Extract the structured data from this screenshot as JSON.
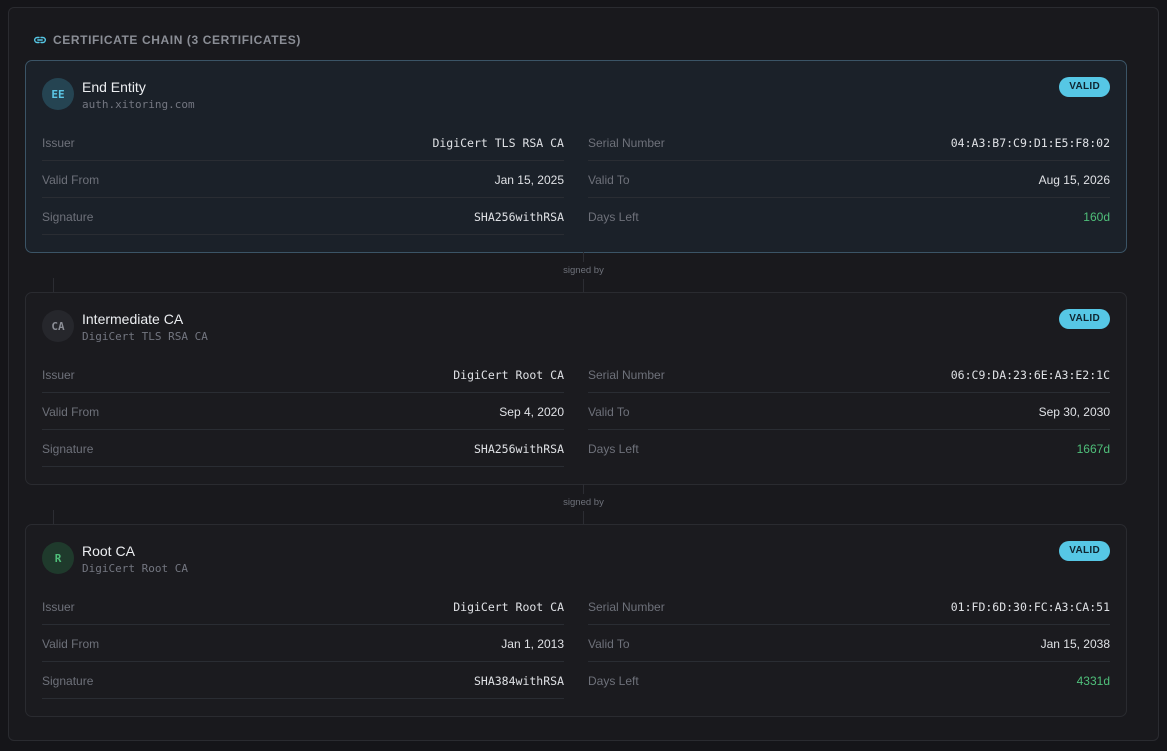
{
  "chain": {
    "title": "CERTIFICATE CHAIN (3 CERTIFICATES)",
    "icon": "link-icon",
    "connector_label": "signed by"
  },
  "certificates": [
    {
      "badge_initials": "EE",
      "name": "End Entity",
      "subject": "auth.xitoring.com",
      "status": "VALID",
      "issuer_label": "Issuer",
      "issuer": "DigiCert TLS RSA CA",
      "serial_label": "Serial Number",
      "serial": "04:A3:B7:C9:D1:E5:F8:02",
      "valid_from_label": "Valid From",
      "valid_from": "Jan 15, 2025",
      "valid_to_label": "Valid To",
      "valid_to": "Aug 15, 2026",
      "signature_label": "Signature",
      "signature": "SHA256withRSA",
      "days_left_label": "Days Left",
      "days_left": "160d"
    },
    {
      "badge_initials": "CA",
      "name": "Intermediate CA",
      "subject": "DigiCert TLS RSA CA",
      "status": "VALID",
      "issuer_label": "Issuer",
      "issuer": "DigiCert Root CA",
      "serial_label": "Serial Number",
      "serial": "06:C9:DA:23:6E:A3:E2:1C",
      "valid_from_label": "Valid From",
      "valid_from": "Sep 4, 2020",
      "valid_to_label": "Valid To",
      "valid_to": "Sep 30, 2030",
      "signature_label": "Signature",
      "signature": "SHA256withRSA",
      "days_left_label": "Days Left",
      "days_left": "1667d"
    },
    {
      "badge_initials": "R",
      "name": "Root CA",
      "subject": "DigiCert Root CA",
      "status": "VALID",
      "issuer_label": "Issuer",
      "issuer": "DigiCert Root CA",
      "serial_label": "Serial Number",
      "serial": "01:FD:6D:30:FC:A3:CA:51",
      "valid_from_label": "Valid From",
      "valid_from": "Jan 1, 2013",
      "valid_to_label": "Valid To",
      "valid_to": "Jan 15, 2038",
      "signature_label": "Signature",
      "signature": "SHA384withRSA",
      "days_left_label": "Days Left",
      "days_left": "4331d"
    }
  ],
  "colors": {
    "valid_badge": "#56c7e5",
    "days_left": "#4fbf7a",
    "leaf_border": "#3b5466"
  }
}
